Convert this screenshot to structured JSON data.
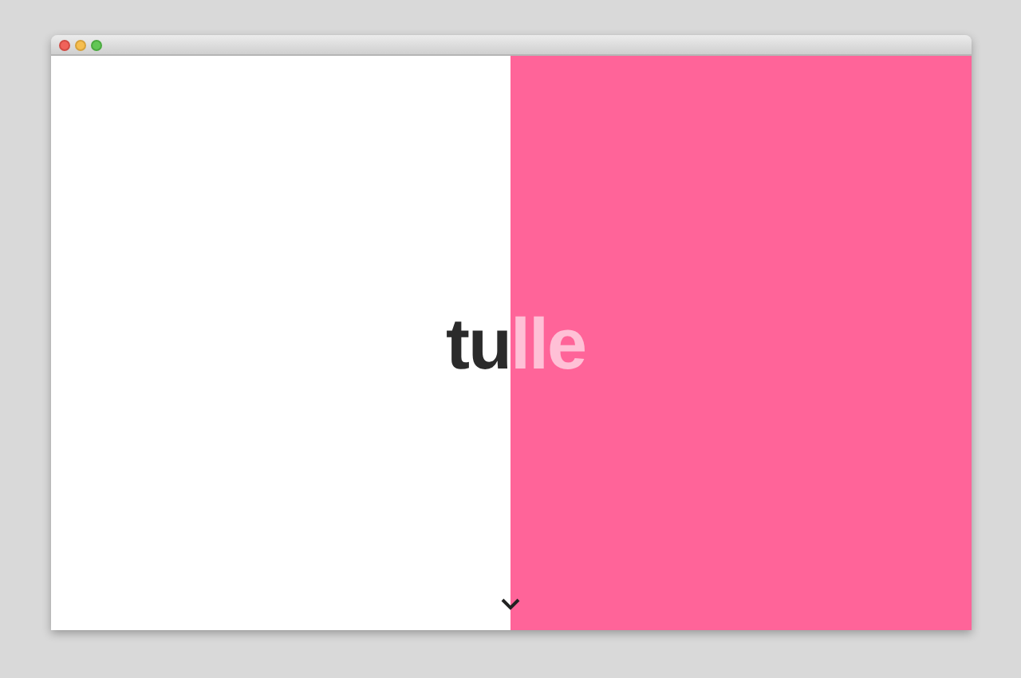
{
  "hero": {
    "left_text": "tu",
    "right_text": "lle"
  }
}
